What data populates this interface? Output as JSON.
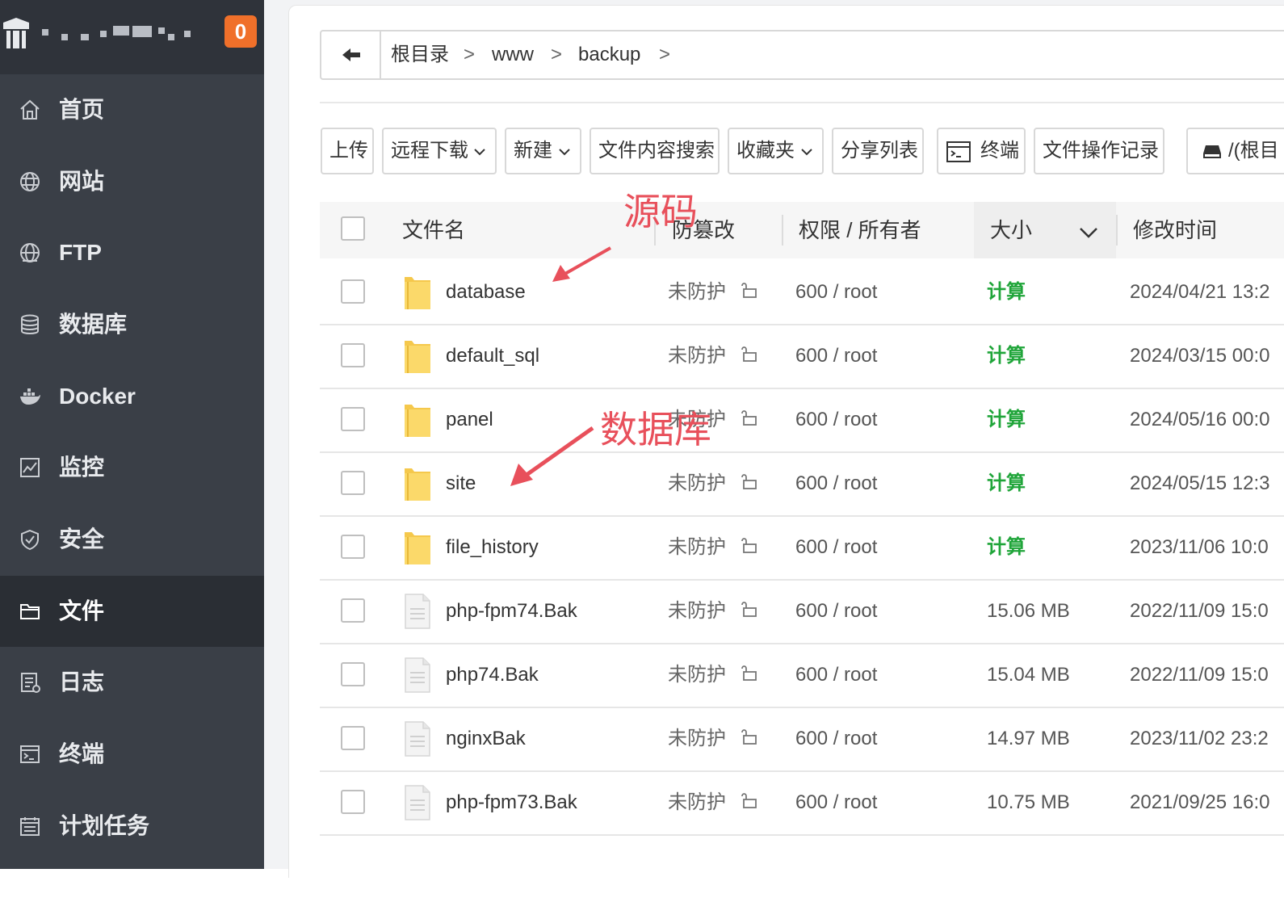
{
  "sidebar": {
    "badge": "0",
    "items": [
      {
        "label": "首页",
        "icon": "home-icon"
      },
      {
        "label": "网站",
        "icon": "globe-icon"
      },
      {
        "label": "FTP",
        "icon": "ftp-globe-icon"
      },
      {
        "label": "数据库",
        "icon": "database-icon"
      },
      {
        "label": "Docker",
        "icon": "docker-icon"
      },
      {
        "label": "监控",
        "icon": "monitor-chart-icon"
      },
      {
        "label": "安全",
        "icon": "shield-icon"
      },
      {
        "label": "文件",
        "icon": "folder-icon"
      },
      {
        "label": "日志",
        "icon": "log-icon"
      },
      {
        "label": "终端",
        "icon": "terminal-icon"
      },
      {
        "label": "计划任务",
        "icon": "calendar-icon"
      }
    ],
    "active": "文件"
  },
  "breadcrumb": {
    "items": [
      "根目录",
      "www",
      "backup"
    ],
    "separator": ">"
  },
  "toolbar": {
    "upload": "上传",
    "remote_download": "远程下载",
    "new": "新建",
    "content_search": "文件内容搜索",
    "favorites": "收藏夹",
    "share_list": "分享列表",
    "terminal": "终端",
    "op_log": "文件操作记录",
    "disk": "/(根目"
  },
  "table": {
    "headers": {
      "name": "文件名",
      "protect": "防篡改",
      "perm": "权限 / 所有者",
      "size": "大小",
      "mtime": "修改时间"
    },
    "rows": [
      {
        "name": "database",
        "type": "folder",
        "protect": "未防护",
        "perm": "600 / root",
        "size": "计算",
        "mtime": "2024/04/21 13:2"
      },
      {
        "name": "default_sql",
        "type": "folder",
        "protect": "未防护",
        "perm": "600 / root",
        "size": "计算",
        "mtime": "2024/03/15 00:0"
      },
      {
        "name": "panel",
        "type": "folder",
        "protect": "未防护",
        "perm": "600 / root",
        "size": "计算",
        "mtime": "2024/05/16 00:0"
      },
      {
        "name": "site",
        "type": "folder",
        "protect": "未防护",
        "perm": "600 / root",
        "size": "计算",
        "mtime": "2024/05/15 12:3"
      },
      {
        "name": "file_history",
        "type": "folder",
        "protect": "未防护",
        "perm": "600 / root",
        "size": "计算",
        "mtime": "2023/11/06 10:0"
      },
      {
        "name": "php-fpm74.Bak",
        "type": "file",
        "protect": "未防护",
        "perm": "600 / root",
        "size": "15.06 MB",
        "mtime": "2022/11/09 15:0"
      },
      {
        "name": "php74.Bak",
        "type": "file",
        "protect": "未防护",
        "perm": "600 / root",
        "size": "15.04 MB",
        "mtime": "2022/11/09 15:0"
      },
      {
        "name": "nginxBak",
        "type": "file",
        "protect": "未防护",
        "perm": "600 / root",
        "size": "14.97 MB",
        "mtime": "2023/11/02 23:2"
      },
      {
        "name": "php-fpm73.Bak",
        "type": "file",
        "protect": "未防护",
        "perm": "600 / root",
        "size": "10.75 MB",
        "mtime": "2021/09/25 16:0"
      }
    ]
  },
  "annotations": {
    "source": "源码",
    "database": "数据库"
  },
  "colors": {
    "sidebar_bg": "#3a3f47",
    "sidebar_active": "#2a2e34",
    "badge": "#f0702a",
    "calc_green": "#20a53a",
    "annotation_red": "#e8505b"
  }
}
